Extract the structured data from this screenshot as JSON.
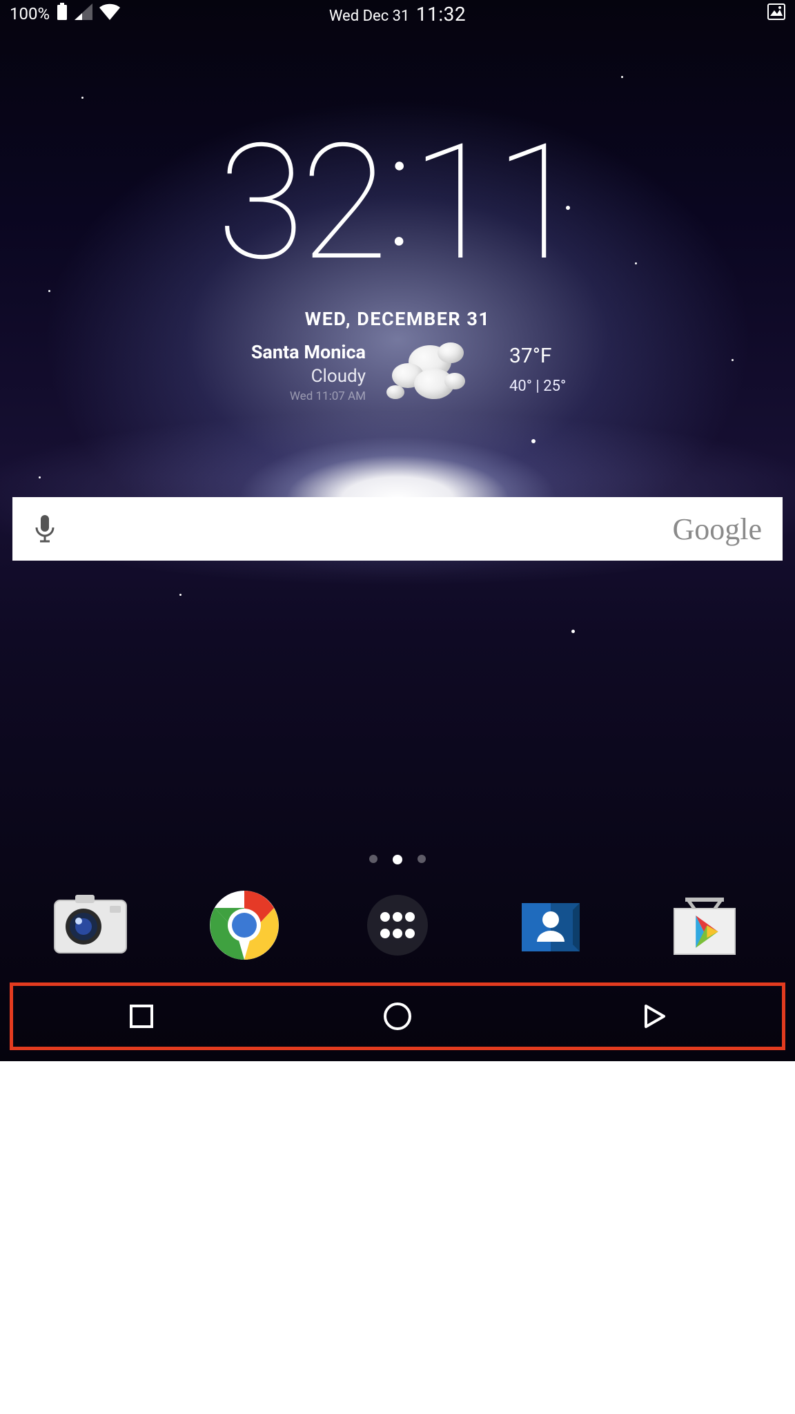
{
  "statusbar": {
    "battery_pct": "100%",
    "date": "Wed Dec 31",
    "time": "11:32"
  },
  "clock": {
    "h": "32",
    "m": "11"
  },
  "weather": {
    "date_line": "WED, DECEMBER 31",
    "location": "Santa Monica",
    "condition": "Cloudy",
    "updated": "Wed 11:07 AM",
    "temp": "37°F",
    "range": "40° | 25°"
  },
  "search": {
    "brand": "Google"
  },
  "page_indicator": {
    "count": 3,
    "active": 1
  },
  "dock": {
    "apps": [
      {
        "name": "camera"
      },
      {
        "name": "chrome"
      },
      {
        "name": "app-drawer"
      },
      {
        "name": "contacts"
      },
      {
        "name": "play-store"
      }
    ]
  },
  "navbar": {
    "buttons": [
      "recent",
      "home",
      "back"
    ]
  }
}
